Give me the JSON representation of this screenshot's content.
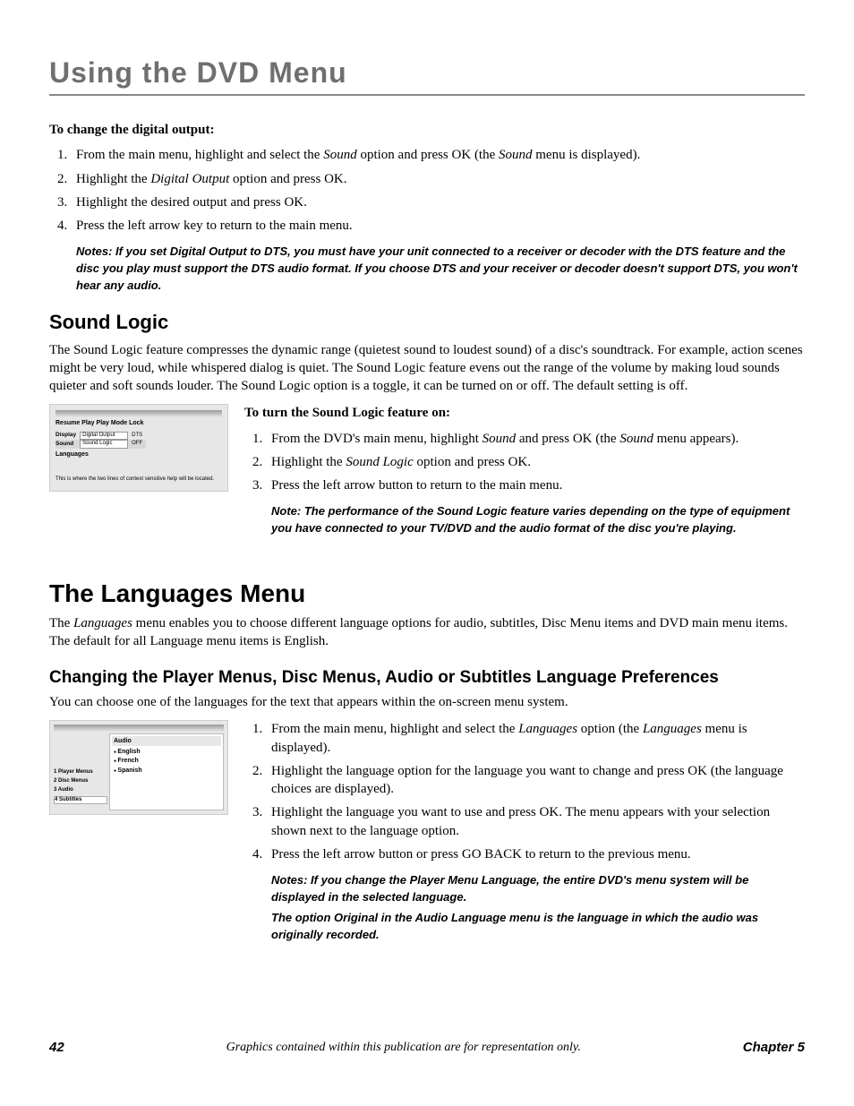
{
  "chapterTitle": "Using the DVD Menu",
  "digitalOutput": {
    "heading": "To change the digital output:",
    "steps": {
      "s1a": "From the main menu, highlight and select the ",
      "s1b": "Sound",
      "s1c": " option and press OK (the ",
      "s1d": "Sound",
      "s1e": " menu is displayed).",
      "s2a": "Highlight the ",
      "s2b": "Digital Output",
      "s2c": " option and press OK.",
      "s3": "Highlight the desired output and press OK.",
      "s4": "Press the left arrow key to return to the main menu."
    },
    "note": "Notes: If you set Digital Output to DTS, you must have your unit connected to a receiver or decoder with the DTS feature and the disc you play must support the DTS audio format. If you choose DTS and your receiver or decoder doesn't support DTS, you won't hear any audio."
  },
  "soundLogic": {
    "heading": "Sound Logic",
    "intro": "The Sound Logic feature compresses the dynamic range (quietest sound to loudest sound) of a disc's soundtrack. For example, action scenes might be very loud, while whispered dialog is quiet. The Sound Logic feature evens out the range of the volume by making loud sounds quieter and soft sounds louder. The Sound Logic option is a toggle, it can be turned on or off. The default setting is off.",
    "subhead": "To turn the Sound Logic feature on:",
    "steps": {
      "s1a": "From the DVD's main menu, highlight ",
      "s1b": "Sound",
      "s1c": " and press OK (the ",
      "s1d": "Sound",
      "s1e": " menu appears).",
      "s2a": "Highlight the ",
      "s2b": "Sound Logic",
      "s2c": " option and press OK.",
      "s3": "Press the left arrow button to return to the main menu."
    },
    "note": "Note: The performance of the Sound Logic feature varies depending on the type of equipment you have connected to your TV/DVD and the audio format of the disc you're playing."
  },
  "screenshot1": {
    "items": {
      "resume": "Resume Play",
      "playmode": "Play Mode",
      "lock": "Lock",
      "display": "Display",
      "sound": "Sound",
      "languages": "Languages"
    },
    "right": {
      "digitalOutputBtn": "Digital Output",
      "digitalOutputVal": "DTS",
      "soundLogicBtn": "Sound Logic",
      "soundLogicVal": "OFF"
    },
    "help": "This is where the two lines of context sensitive help will be located."
  },
  "languagesMenu": {
    "heading": "The Languages Menu",
    "introA": "The ",
    "introB": "Languages",
    "introC": " menu enables you to choose different language options for audio, subtitles, Disc Menu items and DVD main menu items. The default for all Language menu items is English."
  },
  "changingPrefs": {
    "heading": "Changing the Player Menus, Disc Menus, Audio or Subtitles Language Preferences",
    "intro": "You can choose one of the languages for the text that appears within the on-screen menu system.",
    "steps": {
      "s1a": "From the main menu, highlight and select the ",
      "s1b": "Languages",
      "s1c": " option (the ",
      "s1d": "Languages",
      "s1e": " menu is displayed).",
      "s2": "Highlight the language option for the language you want to change and press OK (the language choices are displayed).",
      "s3": "Highlight the language you want to use and press OK. The menu appears with your selection shown next to the language option.",
      "s4": "Press the left arrow button or press GO BACK to return to the previous menu."
    },
    "note1": "Notes: If you change the Player Menu Language, the entire DVD's menu system will be displayed in the selected language.",
    "note2": "The option Original in the Audio Language menu is the language in which the audio was originally recorded."
  },
  "screenshot2": {
    "left": {
      "i1": "1 Player Menus",
      "i2": "2 Disc Menus",
      "i3": "3 Audio",
      "i4": "4 Subtitles"
    },
    "right": {
      "header": "Audio",
      "o1": "English",
      "o2": "French",
      "o3": "Spanish"
    }
  },
  "footer": {
    "page": "42",
    "caption": "Graphics contained within this publication are for representation only.",
    "chapter": "Chapter 5"
  }
}
